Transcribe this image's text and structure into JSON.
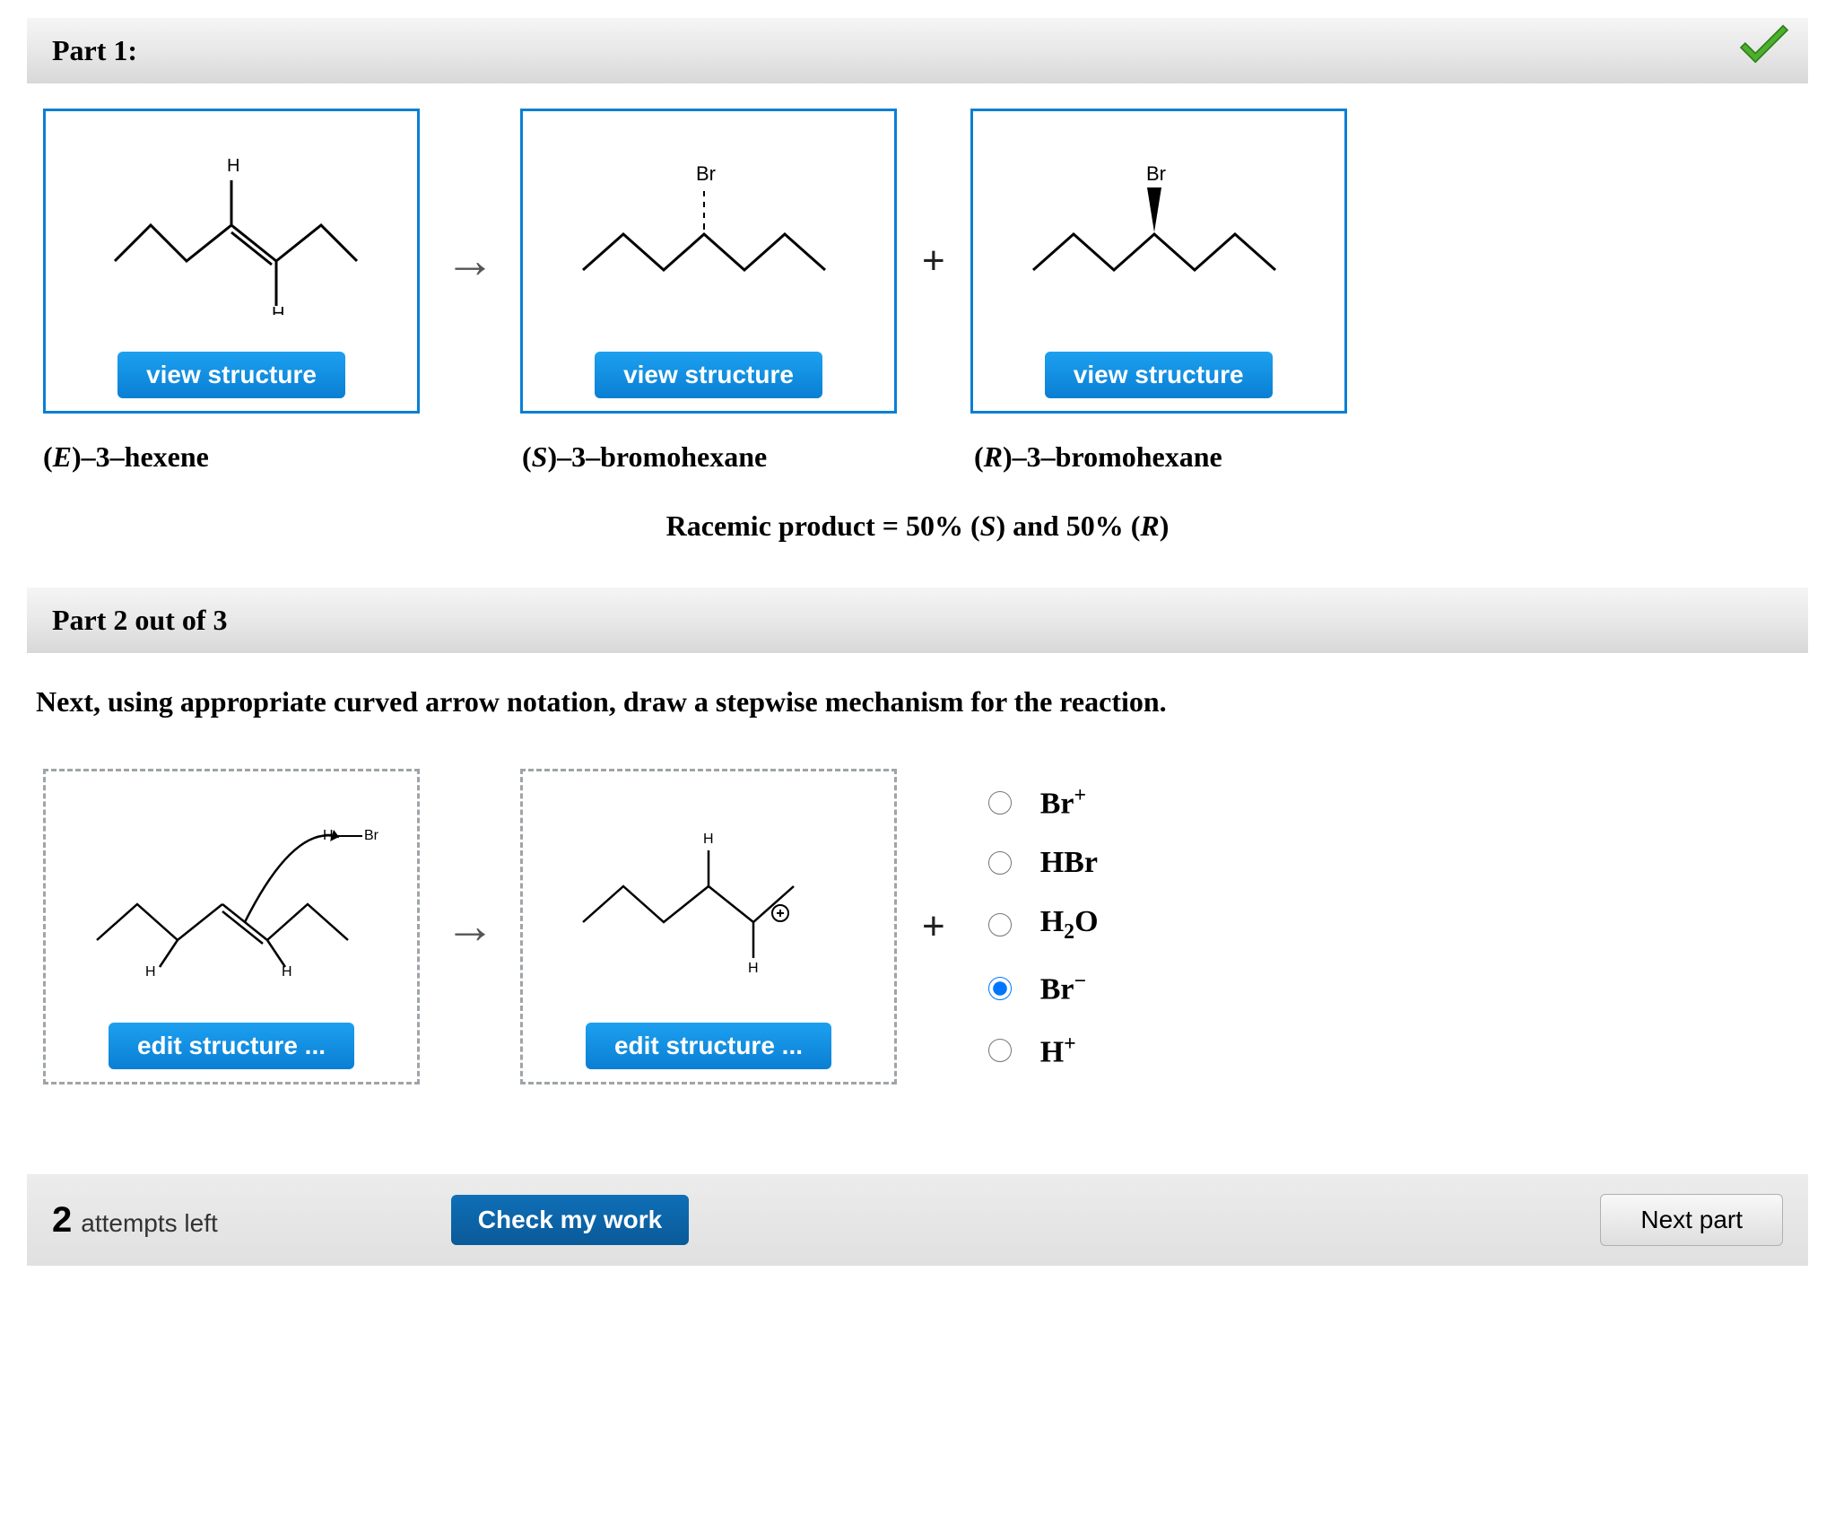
{
  "part1": {
    "title": "Part 1:",
    "structures": [
      {
        "button": "view structure",
        "label_html": "(<i>E</i>)–3–hexene"
      },
      {
        "button": "view structure",
        "label_html": "(<i>S</i>)–3–bromohexane"
      },
      {
        "button": "view structure",
        "label_html": "(<i>R</i>)–3–bromohexane"
      }
    ],
    "arrow": "→",
    "plus": "+",
    "racemic_html": "Racemic product = 50% (<i>S</i>) and 50% (<i>R</i>)"
  },
  "part2": {
    "title": "Part 2 out of 3",
    "instruction": "Next, using appropriate curved arrow notation, draw a stepwise mechanism for the reaction.",
    "edit_boxes": [
      {
        "button": "edit structure ..."
      },
      {
        "button": "edit structure ..."
      }
    ],
    "arrow": "→",
    "plus": "+",
    "radio_options": [
      {
        "label_html": "Br<sup>+</sup>",
        "value": "Br_plus",
        "checked": false
      },
      {
        "label_html": "HBr",
        "value": "HBr",
        "checked": false
      },
      {
        "label_html": "H<sub>2</sub>O",
        "value": "H2O",
        "checked": false
      },
      {
        "label_html": "Br<sup>−</sup>",
        "value": "Br_minus",
        "checked": true
      },
      {
        "label_html": "H<sup>+</sup>",
        "value": "H_plus",
        "checked": false
      }
    ]
  },
  "footer": {
    "attempts_number": "2",
    "attempts_text": "attempts left",
    "check_button": "Check my work",
    "next_button": "Next part"
  }
}
